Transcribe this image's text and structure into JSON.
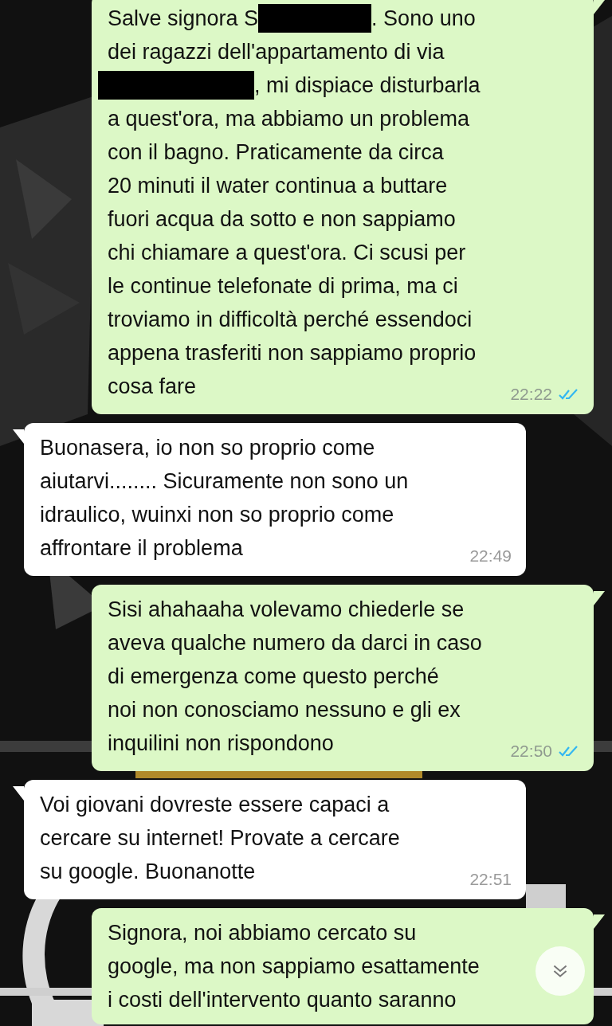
{
  "messages": [
    {
      "kind": "out",
      "lines": [
        [
          {
            "kind": "text",
            "text": "Salve signora S"
          },
          {
            "kind": "redacted"
          },
          {
            "kind": "text",
            "text": ". Sono uno"
          }
        ],
        [
          {
            "kind": "text",
            "text": "dei ragazzi dell'appartamento di via"
          }
        ],
        [
          {
            "kind": "redacted"
          },
          {
            "kind": "text",
            "text": ", mi dispiace disturbarla"
          }
        ],
        [
          {
            "kind": "text",
            "text": "a quest'ora, ma abbiamo un problema"
          }
        ],
        [
          {
            "kind": "text",
            "text": "con il bagno. Praticamente da circa"
          }
        ],
        [
          {
            "kind": "text",
            "text": "20 minuti il water continua a buttare"
          }
        ],
        [
          {
            "kind": "text",
            "text": "fuori acqua da sotto e non sappiamo"
          }
        ],
        [
          {
            "kind": "text",
            "text": "chi chiamare a quest'ora. Ci scusi per"
          }
        ],
        [
          {
            "kind": "text",
            "text": "le continue telefonate di prima, ma ci"
          }
        ],
        [
          {
            "kind": "text",
            "text": "troviamo in difficoltà perché essendoci"
          }
        ],
        [
          {
            "kind": "text",
            "text": "appena trasferiti non sappiamo proprio"
          }
        ],
        [
          {
            "kind": "text",
            "text": "cosa fare"
          }
        ]
      ],
      "time": "22:22",
      "read": true
    },
    {
      "kind": "in",
      "lines": [
        [
          {
            "kind": "text",
            "text": "Buonasera, io non so proprio come"
          }
        ],
        [
          {
            "kind": "text",
            "text": "aiutarvi........ Sicuramente non sono un"
          }
        ],
        [
          {
            "kind": "text",
            "text": "idraulico, wuinxi non so proprio come"
          }
        ],
        [
          {
            "kind": "text",
            "text": "affrontare il problema"
          }
        ]
      ],
      "time": "22:49"
    },
    {
      "kind": "out",
      "lines": [
        [
          {
            "kind": "text",
            "text": "Sisi ahahaaha volevamo chiederle se"
          }
        ],
        [
          {
            "kind": "text",
            "text": "aveva qualche numero da darci in caso"
          }
        ],
        [
          {
            "kind": "text",
            "text": "di emergenza come questo perché"
          }
        ],
        [
          {
            "kind": "text",
            "text": "noi non conosciamo nessuno e gli ex"
          }
        ],
        [
          {
            "kind": "text",
            "text": "inquilini non rispondono"
          }
        ]
      ],
      "time": "22:50",
      "read": true
    },
    {
      "kind": "in",
      "lines": [
        [
          {
            "kind": "text",
            "text": "Voi giovani dovreste essere capaci a"
          }
        ],
        [
          {
            "kind": "text",
            "text": "cercare su internet! Provate a cercare"
          }
        ],
        [
          {
            "kind": "text",
            "text": "su google. Buonanotte"
          }
        ]
      ],
      "time": "22:51"
    },
    {
      "kind": "out",
      "lines": [
        [
          {
            "kind": "text",
            "text": "Signora, noi abbiamo cercato su"
          }
        ],
        [
          {
            "kind": "text",
            "text": "google, ma non sappiamo esattamente"
          }
        ],
        [
          {
            "kind": "text",
            "text": "i costi dell'intervento quanto saranno"
          }
        ]
      ]
    }
  ]
}
